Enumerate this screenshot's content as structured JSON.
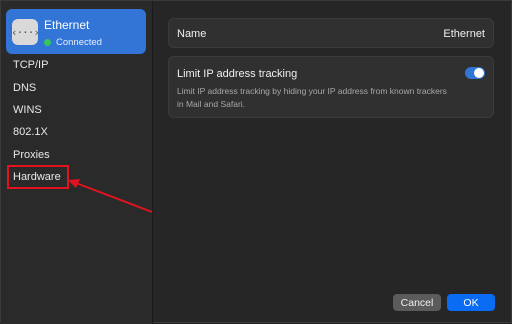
{
  "sidebar": {
    "service": {
      "name": "Ethernet",
      "status": "Connected",
      "icon": "ethernet-arrows-icon",
      "icon_glyph": "‹···›"
    },
    "items": [
      {
        "label": "TCP/IP"
      },
      {
        "label": "DNS"
      },
      {
        "label": "WINS"
      },
      {
        "label": "802.1X"
      },
      {
        "label": "Proxies"
      },
      {
        "label": "Hardware",
        "highlighted": true
      }
    ]
  },
  "main": {
    "name_row": {
      "label": "Name",
      "value": "Ethernet"
    },
    "limit_ip": {
      "title": "Limit IP address tracking",
      "description": "Limit IP address tracking by hiding your IP address from known trackers in Mail and Safari.",
      "enabled": true
    }
  },
  "footer": {
    "cancel_label": "Cancel",
    "ok_label": "OK"
  },
  "colors": {
    "accent": "#3275d6",
    "ok_button": "#0a6cf2",
    "connected_dot": "#34c759",
    "annotation": "#e0141e"
  }
}
